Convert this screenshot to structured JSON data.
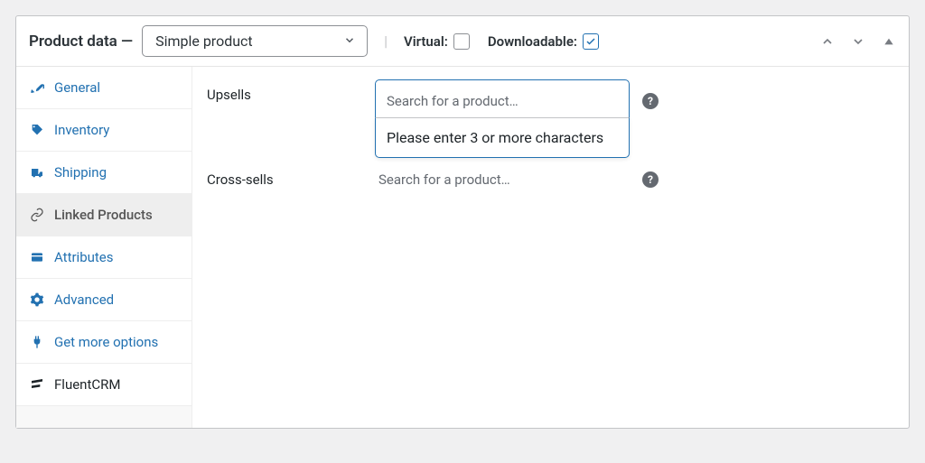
{
  "header": {
    "title": "Product data —",
    "product_type": "Simple product",
    "virtual_label": "Virtual:",
    "downloadable_label": "Downloadable:",
    "virtual_checked": false,
    "downloadable_checked": true
  },
  "sidebar": {
    "tabs": [
      {
        "icon": "wrench",
        "label": "General"
      },
      {
        "icon": "tag",
        "label": "Inventory"
      },
      {
        "icon": "truck",
        "label": "Shipping"
      },
      {
        "icon": "link",
        "label": "Linked Products"
      },
      {
        "icon": "card",
        "label": "Attributes"
      },
      {
        "icon": "gear",
        "label": "Advanced"
      },
      {
        "icon": "plug",
        "label": "Get more options"
      },
      {
        "icon": "fluent",
        "label": "FluentCRM"
      }
    ]
  },
  "content": {
    "upsells_label": "Upsells",
    "upsells_placeholder": "Search for a product…",
    "crosssells_label": "Cross-sells",
    "crosssells_placeholder": "Search for a product…",
    "dropdown_message": "Please enter 3 or more characters",
    "help_symbol": "?"
  }
}
